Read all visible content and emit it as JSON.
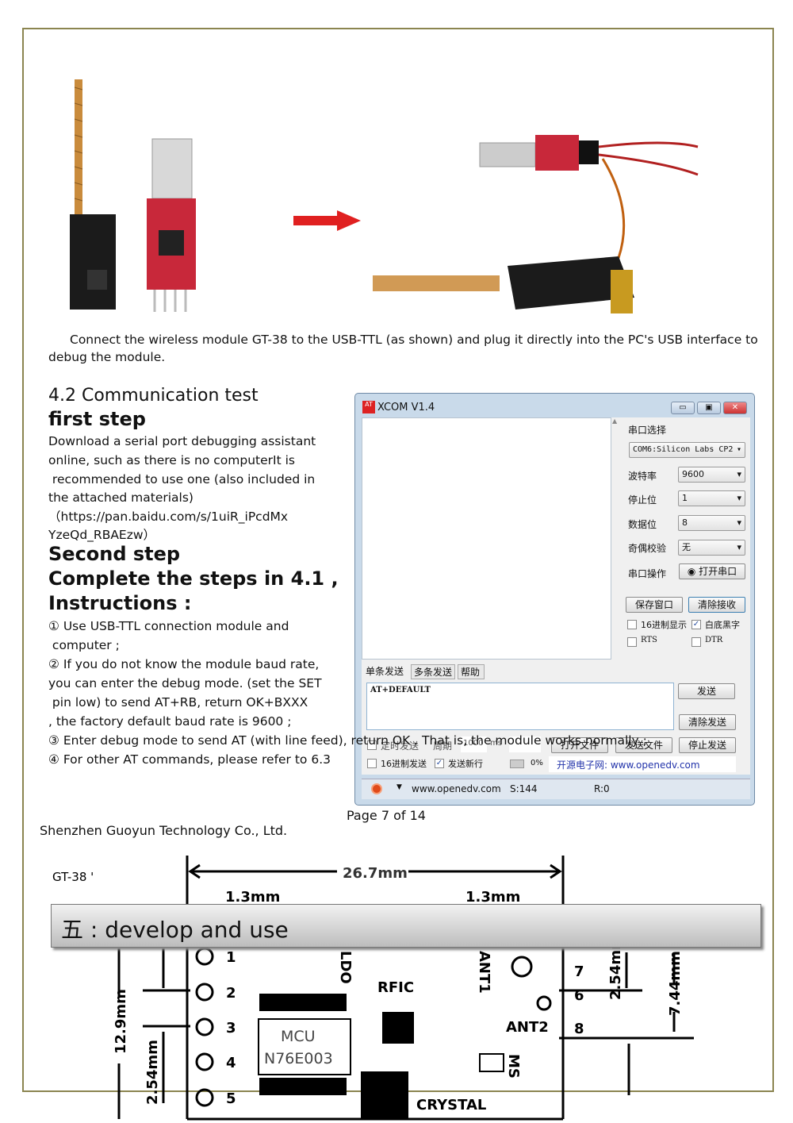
{
  "figure": {
    "arrow_icon": "red-arrow-icon"
  },
  "caption": {
    "line1": "Connect the wireless module GT-38 to the USB-TTL (as shown) and plug it directly into the PC's USB interface to",
    "line2": "debug the module."
  },
  "section": {
    "heading": "4.2 Communication test",
    "step1_title": "first step",
    "step1_lines": [
      "Download a serial port debugging assistant",
      "online, such as there is no computerIt is",
      " recommended to use one (also included in",
      "the attached materials)",
      "（https://pan.baidu.com/s/1uiR_iPcdMx",
      "YzeQd_RBAEzw）"
    ],
    "step2_title": "Second step",
    "step2_sub1": "Complete the steps in 4.1 ,",
    "step2_sub2": "Instructions :",
    "instructions": [
      "① Use USB-TTL connection module and",
      " computer ;",
      "② If you do not know the module baud rate,",
      "you can enter the debug mode. (set the SET",
      " pin low) to send AT+RB, return OK+BXXX",
      ", the factory default baud rate is 9600 ;",
      "③ Enter debug mode to send AT (with line feed), return OK . That is, the module works normally ;",
      "④ For other AT commands, please refer to 6.3"
    ]
  },
  "xcom": {
    "title": "XCOM V1.4",
    "port_label": "串口选择",
    "port_value": "COM6:Silicon Labs CP2",
    "baud_label": "波特率",
    "baud_value": "9600",
    "stop_label": "停止位",
    "stop_value": "1",
    "data_label": "数据位",
    "data_value": "8",
    "parity_label": "奇偶校验",
    "parity_value": "无",
    "op_label": "串口操作",
    "open_button": "打开串口",
    "save_button": "保存窗口",
    "clear_recv_button": "清除接收",
    "hex_display": "16进制显示",
    "white_bg": "白底黑字",
    "rts": "RTS",
    "dtr": "DTR",
    "tabs": [
      "单条发送",
      "多条发送",
      "帮助"
    ],
    "send_text": "AT+DEFAULT",
    "send_button": "发送",
    "clear_send_button": "清除发送",
    "timed_send": "定时发送",
    "period_label": "周期",
    "period_value": "1000",
    "period_unit": "ms",
    "open_file_button": "打开文件",
    "send_file_button": "发送文件",
    "stop_send_button": "停止发送",
    "hex_send": "16进制发送",
    "send_newline": "发送新行",
    "progress": "0%",
    "link": "开源电子网: www.openedv.com",
    "status_url": "www.openedv.com",
    "status_s": "S:144",
    "status_r": "R:0"
  },
  "footer": {
    "page": "Page 7 of 14",
    "company": "Shenzhen Guoyun Technology Co., Ltd."
  },
  "diagram": {
    "label": "GT-38 '",
    "width": "26.7mm",
    "margin_left": "1.3mm",
    "margin_right": "1.3mm",
    "height": "12.9mm",
    "pitch_left": "2.54mm",
    "pitch_right": "2.54mm",
    "ant_offset": "7.44mm",
    "pins_left": [
      "1",
      "2",
      "3",
      "4",
      "5"
    ],
    "pins_right": [
      "7",
      "6",
      "8"
    ],
    "ldo": "LDO",
    "rfic": "RFIC",
    "mcu": "MCU",
    "mcu_part": "N76E003",
    "ant1": "ANT1",
    "ant2": "ANT2",
    "ms": "MS",
    "crystal": "CRYSTAL"
  },
  "banner": {
    "title": "五 : develop and use"
  }
}
